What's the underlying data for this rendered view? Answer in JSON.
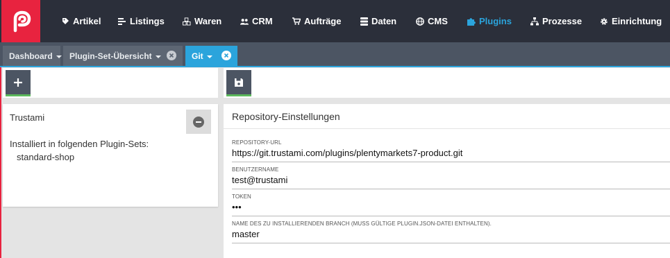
{
  "nav": {
    "logo_icon": "plenty-logo-icon",
    "items": [
      {
        "label": "Artikel",
        "icon": "tag-icon"
      },
      {
        "label": "Listings",
        "icon": "list-icon"
      },
      {
        "label": "Waren",
        "icon": "cubes-icon"
      },
      {
        "label": "CRM",
        "icon": "users-icon"
      },
      {
        "label": "Aufträge",
        "icon": "cart-icon"
      },
      {
        "label": "Daten",
        "icon": "database-icon"
      },
      {
        "label": "CMS",
        "icon": "globe-icon"
      },
      {
        "label": "Plugins",
        "icon": "puzzle-icon",
        "active": true
      },
      {
        "label": "Prozesse",
        "icon": "sitemap-icon"
      },
      {
        "label": "Einrichtung",
        "icon": "gear-icon"
      }
    ],
    "active_color": "#2ba4dc"
  },
  "tabs": [
    {
      "label": "Dashboard",
      "closable": false
    },
    {
      "label": "Plugin-Set-Übersicht",
      "closable": true
    },
    {
      "label": "Git",
      "closable": true,
      "active": true
    }
  ],
  "toolbar_left": {
    "button_icon": "plus-icon"
  },
  "toolbar_right": {
    "button_icon": "save-icon"
  },
  "plugin_card": {
    "name": "Trustami",
    "installed_label": "Installiert in folgenden Plugin-Sets:",
    "plugin_sets": [
      "standard-shop"
    ],
    "remove_icon": "minus-circle-icon"
  },
  "repository": {
    "title": "Repository-Einstellungen",
    "fields": [
      {
        "label": "REPOSITORY-URL",
        "value": "https://git.trustami.com/plugins/plentymarkets7-product.git"
      },
      {
        "label": "BENUTZERNAME",
        "value": "test@trustami"
      },
      {
        "label": "TOKEN",
        "value": "•••"
      },
      {
        "label": "NAME DES ZU INSTALLIERENDEN BRANCH (MUSS GÜLTIGE PLUGIN.JSON-DATEI ENTHALTEN).",
        "value": "master"
      }
    ]
  },
  "colors": {
    "brand": "#e8233f",
    "accent": "#2ba4dc",
    "nav_bg": "#2b2f3a",
    "tab_bg": "#4c5563",
    "success": "#5cb85c"
  }
}
